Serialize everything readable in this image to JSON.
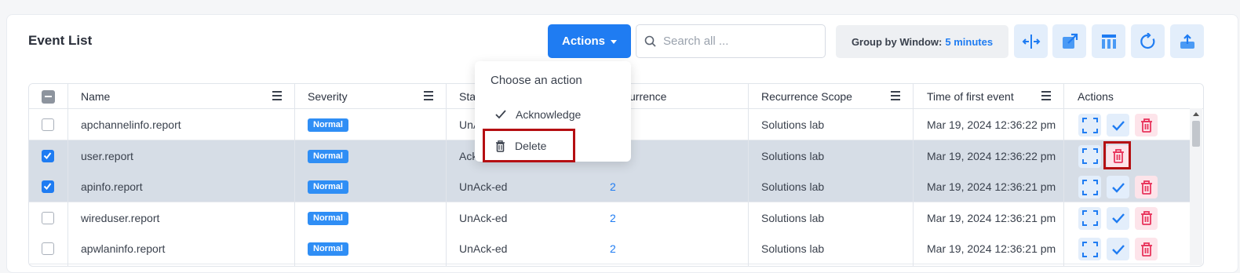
{
  "header": {
    "title": "Event List",
    "actions_label": "Actions",
    "search_placeholder": "Search all ...",
    "group_label": "Group by Window:",
    "group_value": "5 minutes"
  },
  "toolbar_icons": [
    "split-horizontal-icon",
    "export-icon",
    "columns-icon",
    "refresh-icon",
    "upload-icon"
  ],
  "table": {
    "columns": [
      "Name",
      "Severity",
      "Status",
      "Recurrence",
      "Recurrence Scope",
      "Time of first event",
      "Actions"
    ],
    "visible_header_fragments": {
      "status": "Sta",
      "recurrence": "urrence"
    },
    "rows": [
      {
        "selected": false,
        "name": "apchannelinfo.report",
        "severity": "Normal",
        "status": "UnA",
        "recurrence": "",
        "scope": "Solutions lab",
        "time": "Mar 19, 2024 12:36:22 pm"
      },
      {
        "selected": true,
        "name": "user.report",
        "severity": "Normal",
        "status": "Ack",
        "recurrence": "",
        "scope": "Solutions lab",
        "time": "Mar 19, 2024 12:36:22 pm"
      },
      {
        "selected": true,
        "name": "apinfo.report",
        "severity": "Normal",
        "status": "UnAck-ed",
        "recurrence": "2",
        "scope": "Solutions lab",
        "time": "Mar 19, 2024 12:36:21 pm"
      },
      {
        "selected": false,
        "name": "wireduser.report",
        "severity": "Normal",
        "status": "UnAck-ed",
        "recurrence": "2",
        "scope": "Solutions lab",
        "time": "Mar 19, 2024 12:36:21 pm"
      },
      {
        "selected": false,
        "name": "apwlaninfo.report",
        "severity": "Normal",
        "status": "UnAck-ed",
        "recurrence": "2",
        "scope": "Solutions lab",
        "time": "Mar 19, 2024 12:36:21 pm"
      }
    ]
  },
  "dropdown": {
    "title": "Choose an action",
    "items": [
      "Acknowledge",
      "Delete"
    ]
  },
  "colors": {
    "accent": "#1f7cf2",
    "highlight": "#b50f12",
    "delete": "#e8345c"
  }
}
